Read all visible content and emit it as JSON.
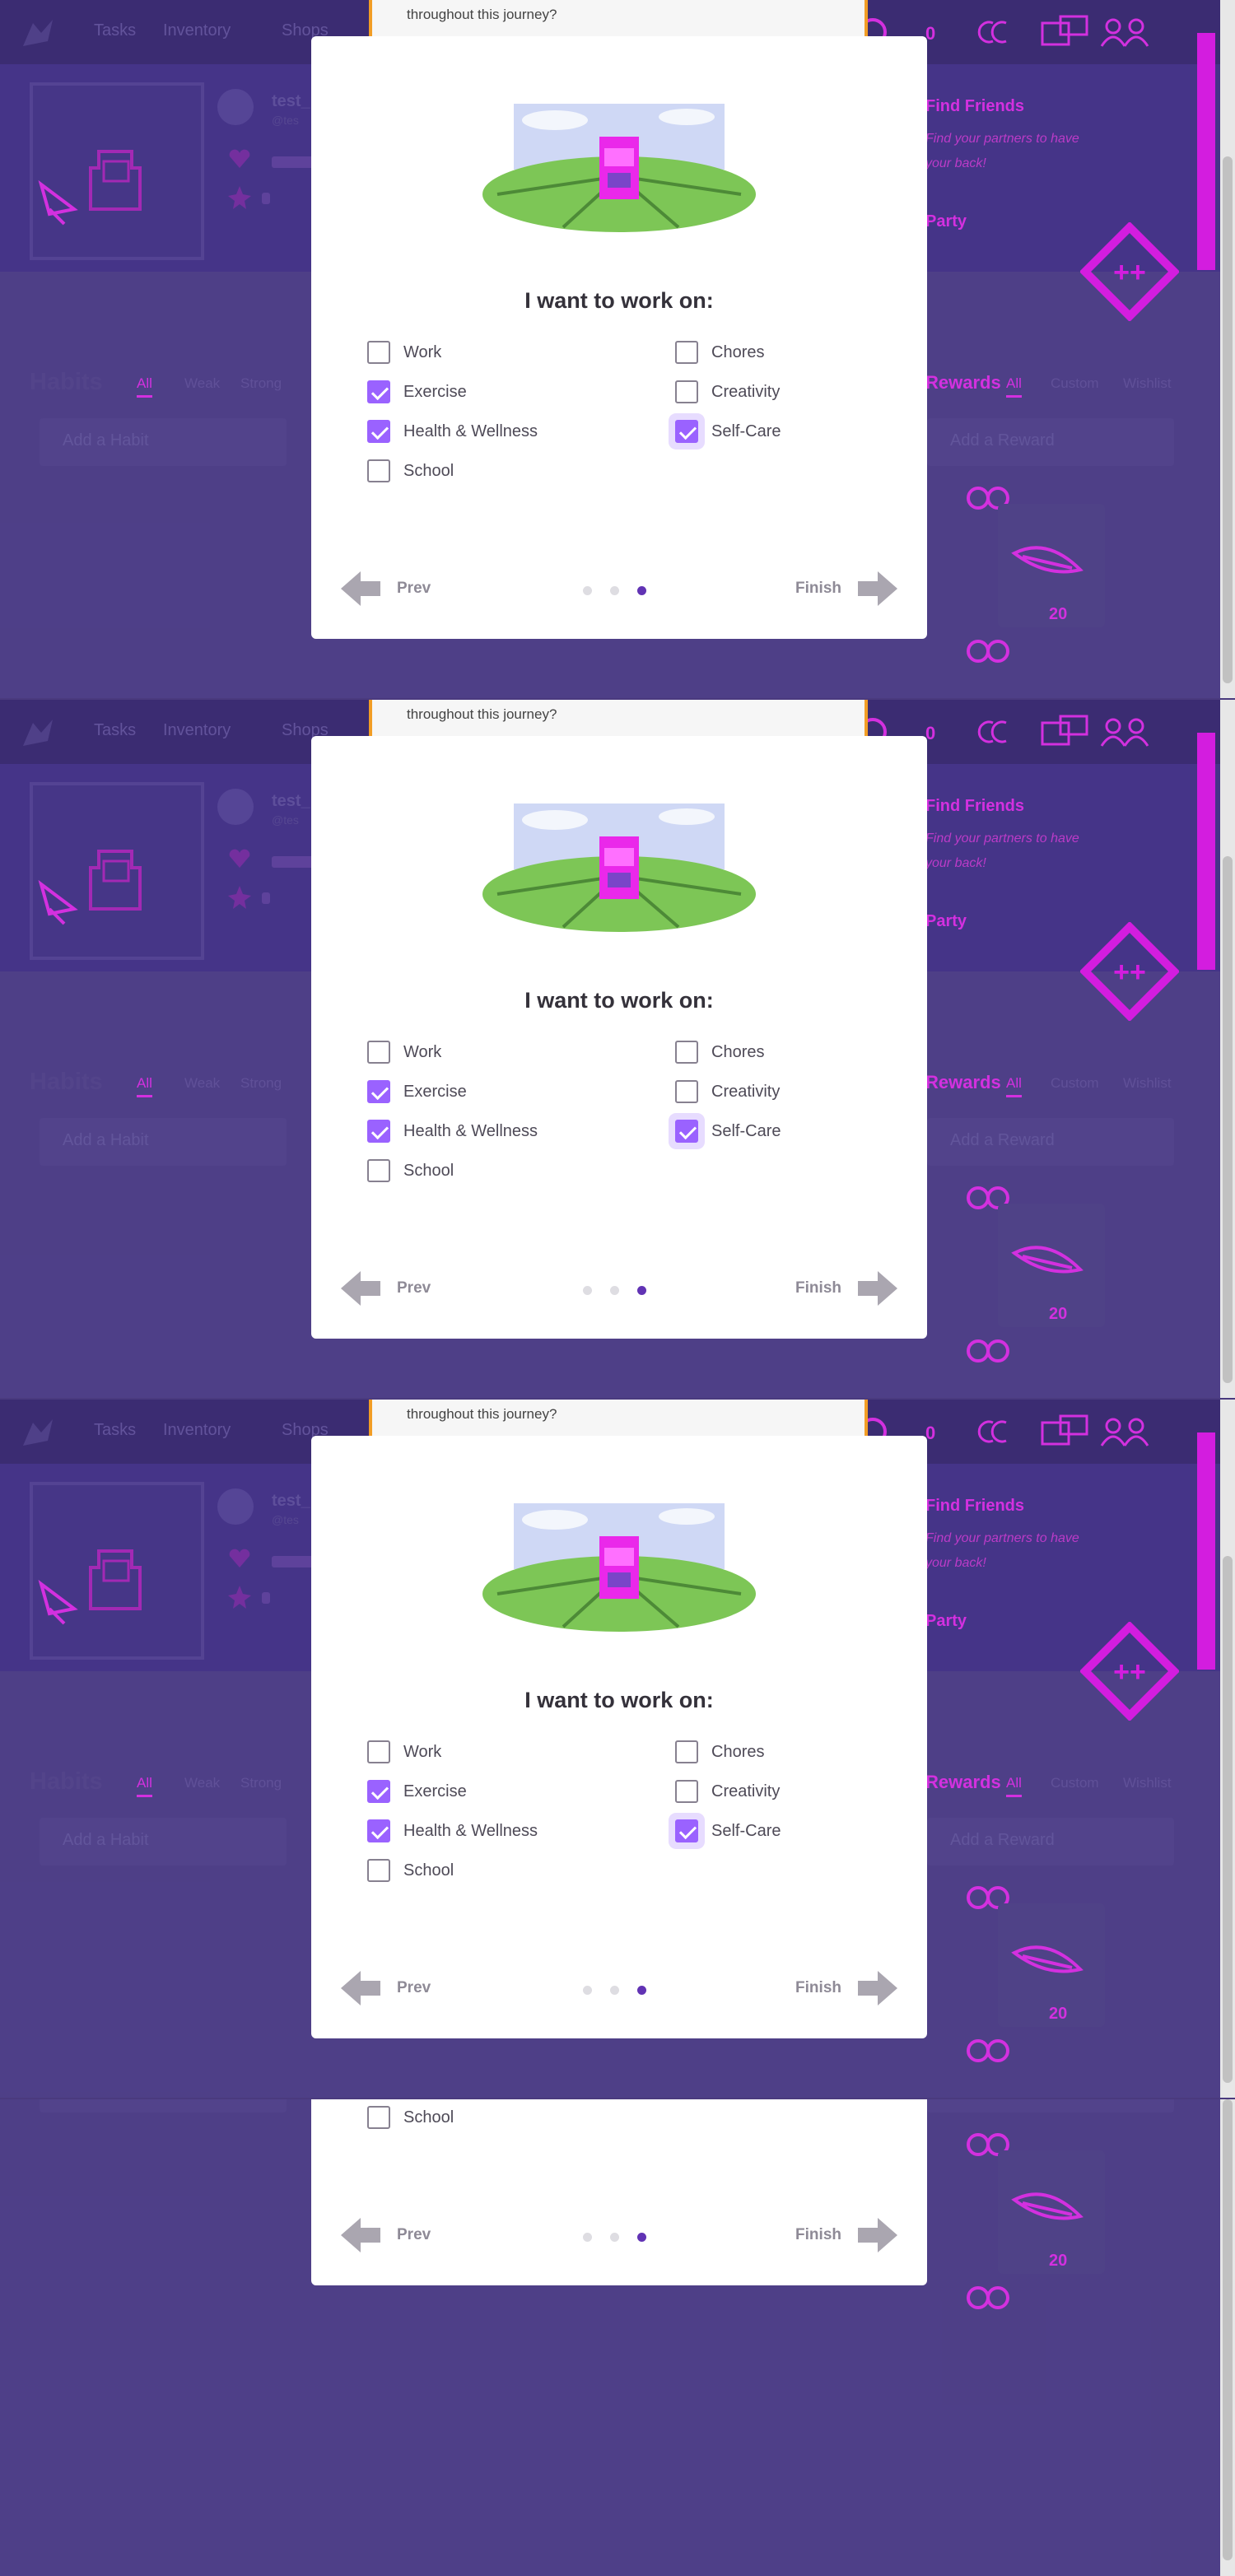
{
  "app": {
    "nav": [
      "Tasks",
      "Inventory",
      "Shops"
    ],
    "gold_count": "0",
    "user_name_fragment": "test_",
    "user_handle_fragment": "@tes"
  },
  "background": {
    "habits_title": "Habits",
    "habit_tabs": [
      "All",
      "Weak",
      "Strong"
    ],
    "add_habit_placeholder": "Add a Habit",
    "rewards_title": "Rewards",
    "reward_tabs": [
      "All",
      "Custom",
      "Wishlist"
    ],
    "add_reward_placeholder": "Add a Reward",
    "party_title": "Find Friends",
    "party_line1": "Find your partners to have",
    "party_line2": "your back!",
    "party_title2": "Party",
    "reward_price": "20"
  },
  "onboarding": {
    "intro_text": "throughout this journey?",
    "heading": "I want to work on:",
    "options": [
      {
        "label": "Work",
        "checked": false
      },
      {
        "label": "Exercise",
        "checked": true
      },
      {
        "label": "Health & Wellness",
        "checked": true
      },
      {
        "label": "School",
        "checked": false
      },
      {
        "label": "Chores",
        "checked": false
      },
      {
        "label": "Creativity",
        "checked": false
      },
      {
        "label": "Self-Care",
        "checked": true
      }
    ],
    "prev_label": "Prev",
    "finish_label": "Finish",
    "steps": 3,
    "current_step": 3
  },
  "colors": {
    "accent": "#9a62ff",
    "progress_dot": "#6133b4",
    "magenta_overlay": "#ff1aff",
    "frame_border": "#f29d25"
  },
  "icons": [
    "gryphon-logo-icon",
    "sync-icon",
    "gift-icon",
    "party-icon",
    "pencil-cursor-icon",
    "heart-icon",
    "star-icon",
    "gem-icon",
    "feather-icon",
    "add-task-icon",
    "prev-arrow-icon",
    "next-arrow-icon"
  ]
}
